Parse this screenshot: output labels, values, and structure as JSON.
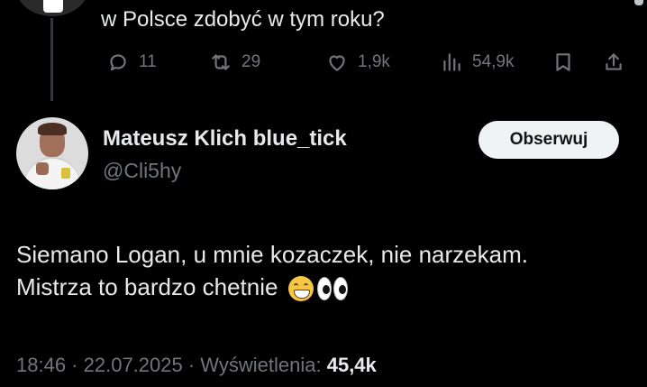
{
  "previous_tweet": {
    "text_fragment": "w Polsce zdobyć w tym roku?",
    "actions": {
      "replies": "11",
      "reposts": "29",
      "likes": "1,9k",
      "views": "54,9k"
    }
  },
  "tweet": {
    "author_name": "Mateusz Klich blue_tick",
    "author_handle": "@Cli5hy",
    "follow_label": "Obserwuj",
    "body_line1": "Siemano Logan, u mnie kozaczek, nie narzekam.",
    "body_line2": "Mistrza to bardzo chetnie",
    "time": "18:46",
    "separator": " · ",
    "date": "22.07.2025",
    "views_label": "Wyświetlenia:",
    "views_count": "45,4k"
  },
  "icons": {
    "reply": "reply-icon",
    "repost": "repost-icon",
    "like": "heart-icon",
    "views": "views-bar-chart-icon",
    "bookmark": "bookmark-icon",
    "share": "share-icon"
  },
  "colors": {
    "background": "#000000",
    "text_primary": "#e7e9ea",
    "text_secondary": "#71767b",
    "follow_button_bg": "#eff3f4"
  }
}
